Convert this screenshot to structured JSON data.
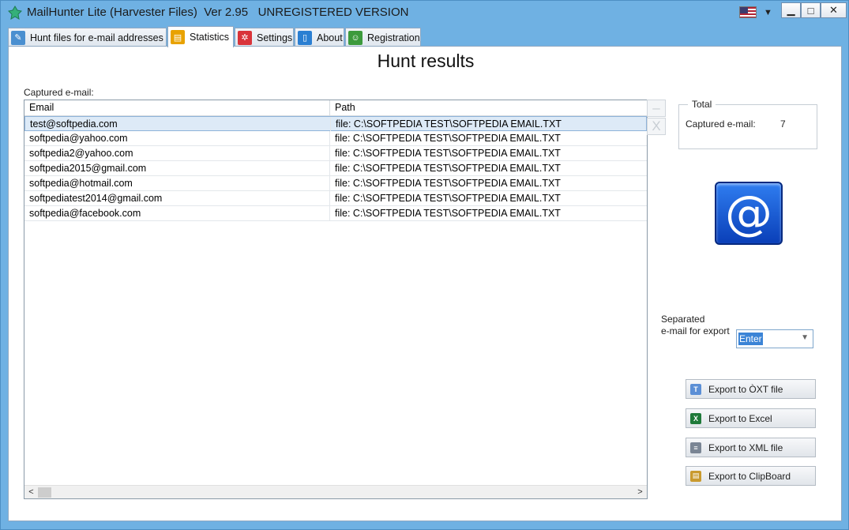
{
  "window": {
    "title": "MailHunter Lite (Harvester Files)  Ver 2.95   UNREGISTERED VERSION",
    "min_label": "▁",
    "max_label": "□",
    "close_label": "✕",
    "lang_dropdown": "▼"
  },
  "tabs": [
    {
      "label": "Hunt files for e-mail addresses",
      "icon": "document-search-icon",
      "color": "#4a8fd0"
    },
    {
      "label": "Statistics",
      "icon": "notebook-icon",
      "color": "#e8a200"
    },
    {
      "label": "Settings",
      "icon": "gear-icon",
      "color": "#d9343a"
    },
    {
      "label": "About",
      "icon": "book-icon",
      "color": "#2a7fd2"
    },
    {
      "label": "Registration",
      "icon": "user-icon",
      "color": "#3c9a3c"
    }
  ],
  "main": {
    "title": "Hunt results",
    "captured_label": "Captured e-mail:",
    "columns": [
      "Email",
      "Path"
    ],
    "rows": [
      [
        "test@softpedia.com",
        "file: C:\\SOFTPEDIA TEST\\SOFTPEDIA EMAIL.TXT"
      ],
      [
        "softpedia@yahoo.com",
        "file: C:\\SOFTPEDIA TEST\\SOFTPEDIA EMAIL.TXT"
      ],
      [
        "softpedia2@yahoo.com",
        "file: C:\\SOFTPEDIA TEST\\SOFTPEDIA EMAIL.TXT"
      ],
      [
        "softpedia2015@gmail.com",
        "file: C:\\SOFTPEDIA TEST\\SOFTPEDIA EMAIL.TXT"
      ],
      [
        "softpedia@hotmail.com",
        "file: C:\\SOFTPEDIA TEST\\SOFTPEDIA EMAIL.TXT"
      ],
      [
        "softpediatest2014@gmail.com",
        "file: C:\\SOFTPEDIA TEST\\SOFTPEDIA EMAIL.TXT"
      ],
      [
        "softpedia@facebook.com",
        "file: C:\\SOFTPEDIA TEST\\SOFTPEDIA EMAIL.TXT"
      ]
    ],
    "scroll_left": "<",
    "scroll_right": ">",
    "remove_label": "–",
    "clear_label": "X"
  },
  "total": {
    "legend": "Total",
    "captured_label": "Captured e-mail:",
    "captured_value": "7"
  },
  "at_symbol": "@",
  "separator": {
    "label_line1": "Separated",
    "label_line2": "e-mail for export",
    "selected": "Enter",
    "arrow": "▼"
  },
  "export_buttons": [
    {
      "label": "Export to ÒXT file",
      "icon": "text-file-icon",
      "color": "#5b8fd6",
      "glyph": "T"
    },
    {
      "label": "Export to Excel",
      "icon": "excel-icon",
      "color": "#1f7a3a",
      "glyph": "X"
    },
    {
      "label": "Export to XML file",
      "icon": "xml-file-icon",
      "color": "#7a8594",
      "glyph": "≡"
    },
    {
      "label": "Export to ClipBoard",
      "icon": "clipboard-icon",
      "color": "#c99a2e",
      "glyph": "▤"
    }
  ]
}
